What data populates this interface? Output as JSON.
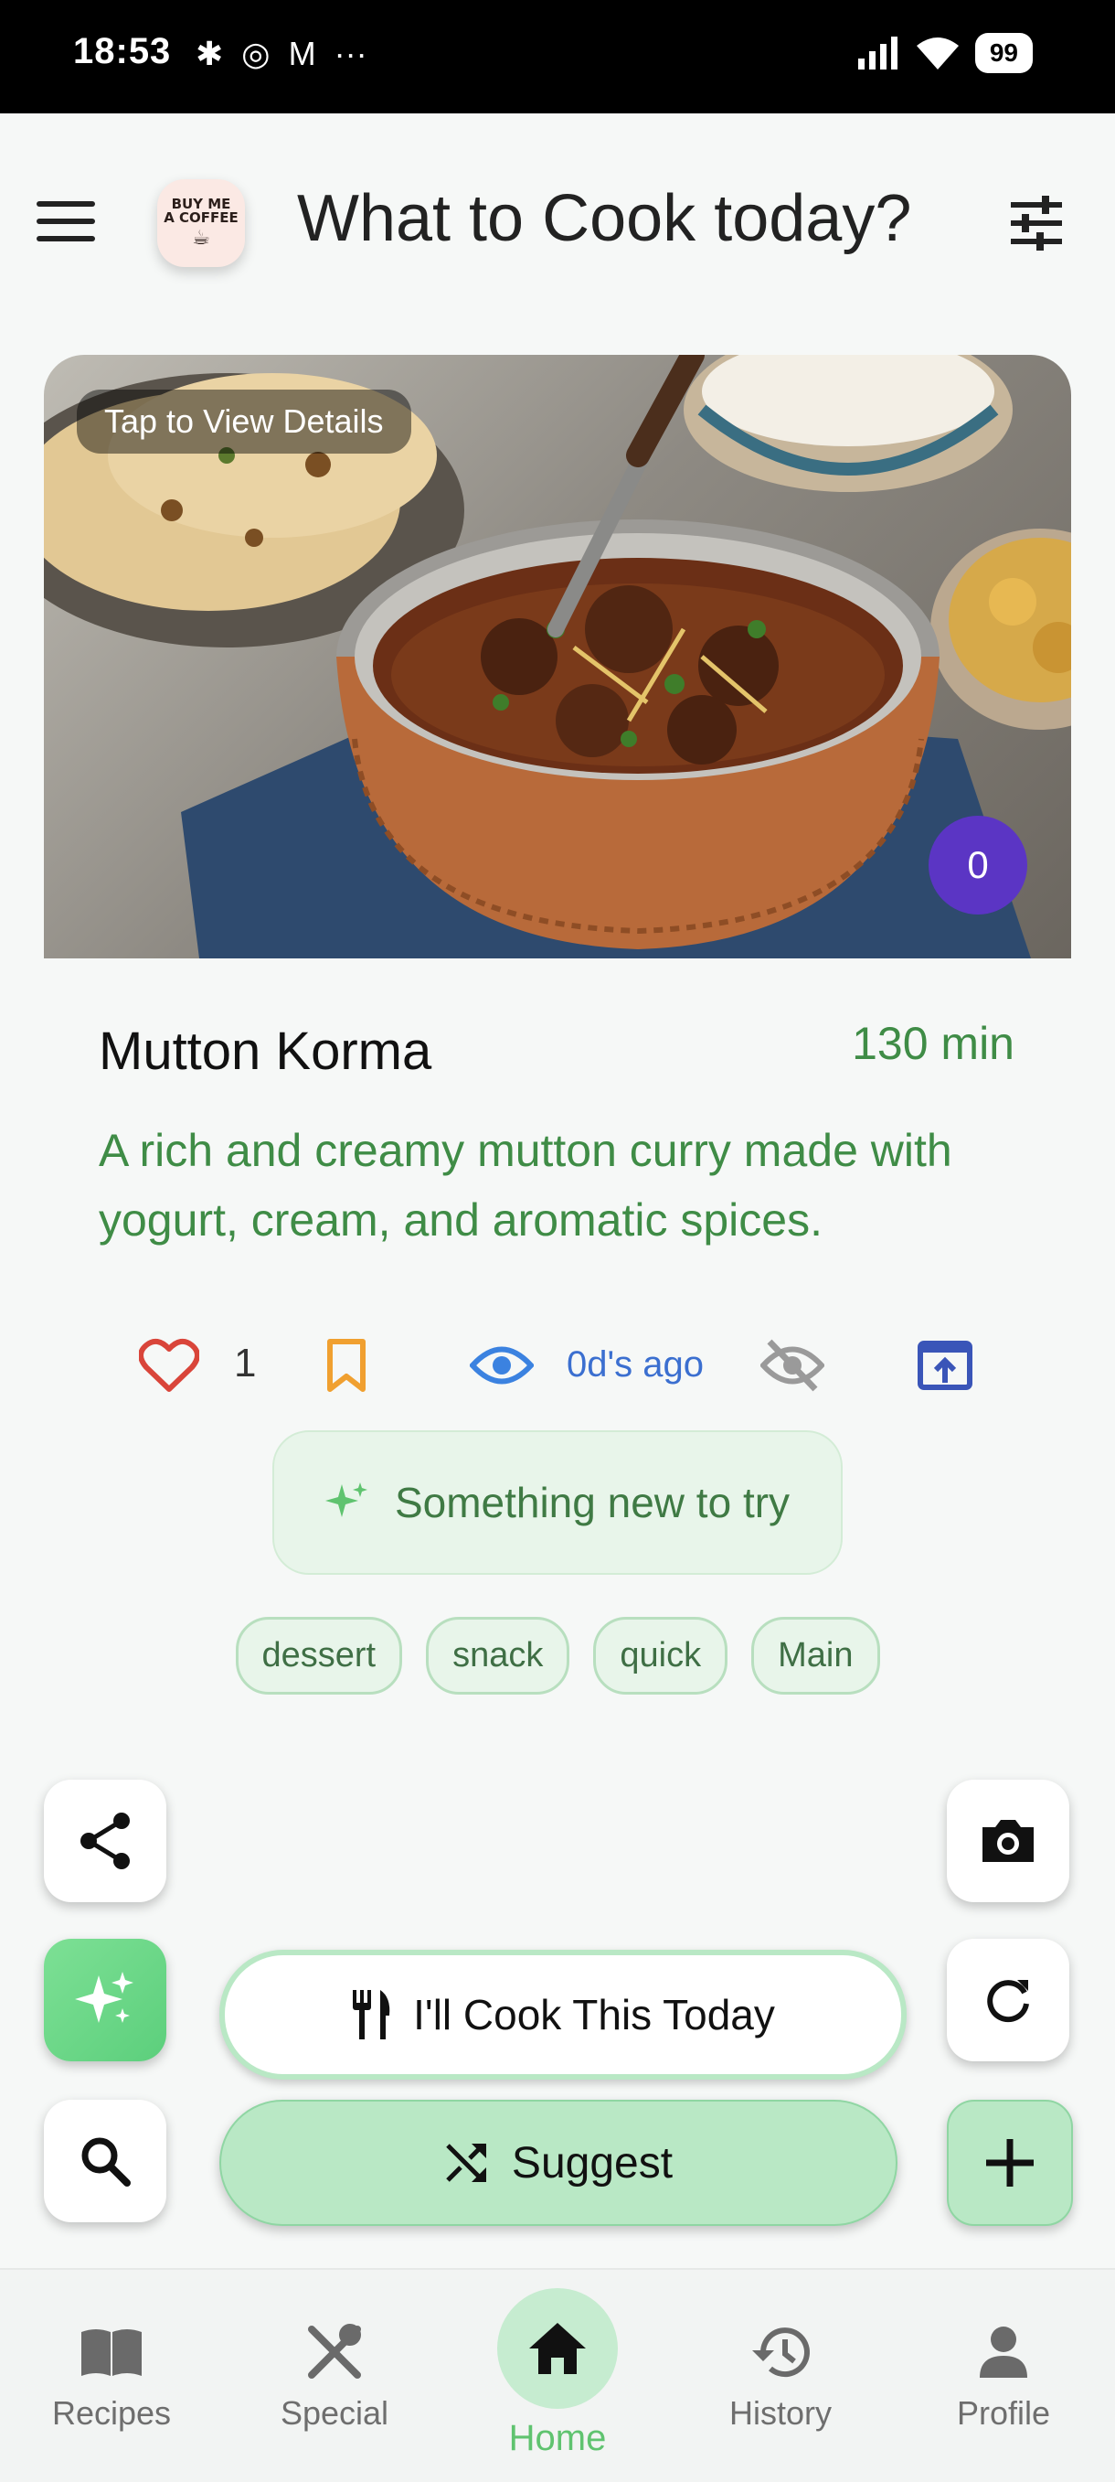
{
  "status_bar": {
    "time": "18:53",
    "battery": "99"
  },
  "header": {
    "title": "What to Cook today?",
    "logo_text": [
      "BUY ME",
      "A COFFEE"
    ]
  },
  "card": {
    "overlay_label": "Tap to View Details",
    "count_badge": "0",
    "name": "Mutton Korma",
    "time": "130 min",
    "description": "A rich and creamy mutton curry made with yogurt, cream, and aromatic spices.",
    "likes": "1",
    "viewed_ago": "0d's ago",
    "highlight_chip": "Something new to try",
    "tags": [
      "dessert",
      "snack",
      "quick",
      "Main"
    ]
  },
  "actions": {
    "cook_today": "I'll Cook This Today",
    "suggest": "Suggest"
  },
  "bottom_nav": {
    "items": [
      {
        "label": "Recipes",
        "icon": "book-icon"
      },
      {
        "label": "Special",
        "icon": "utensils-crossed-icon"
      },
      {
        "label": "Home",
        "icon": "home-icon",
        "active": true
      },
      {
        "label": "History",
        "icon": "history-icon"
      },
      {
        "label": "Profile",
        "icon": "person-icon"
      }
    ]
  },
  "colors": {
    "accent_green": "#3f8c46",
    "chip_bg": "#e8f5ea",
    "badge_purple": "#5b35c4",
    "primary_light": "#b9e8c5"
  }
}
